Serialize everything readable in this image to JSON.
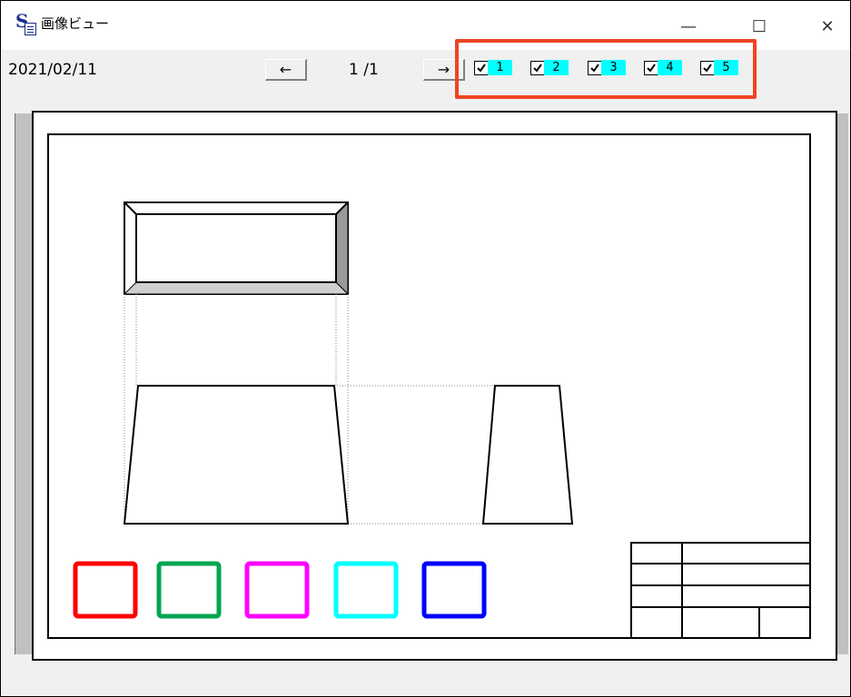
{
  "window": {
    "title": "画像ビュー",
    "minimize_glyph": "—",
    "maximize_glyph": "☐",
    "close_glyph": "✕"
  },
  "toolbar": {
    "date": "2021/02/11",
    "prev_label": "←",
    "next_label": "→",
    "page_indicator": "1 /1"
  },
  "layers": [
    {
      "label": "1",
      "checked": true
    },
    {
      "label": "2",
      "checked": true
    },
    {
      "label": "3",
      "checked": true
    },
    {
      "label": "4",
      "checked": true
    },
    {
      "label": "5",
      "checked": true
    }
  ],
  "colors": {
    "highlight_border": "#ee4422",
    "layer_label_bg": "#00ffff",
    "legend": [
      "#ff0000",
      "#00a550",
      "#ff00ff",
      "#00ffff",
      "#0000ff"
    ]
  }
}
